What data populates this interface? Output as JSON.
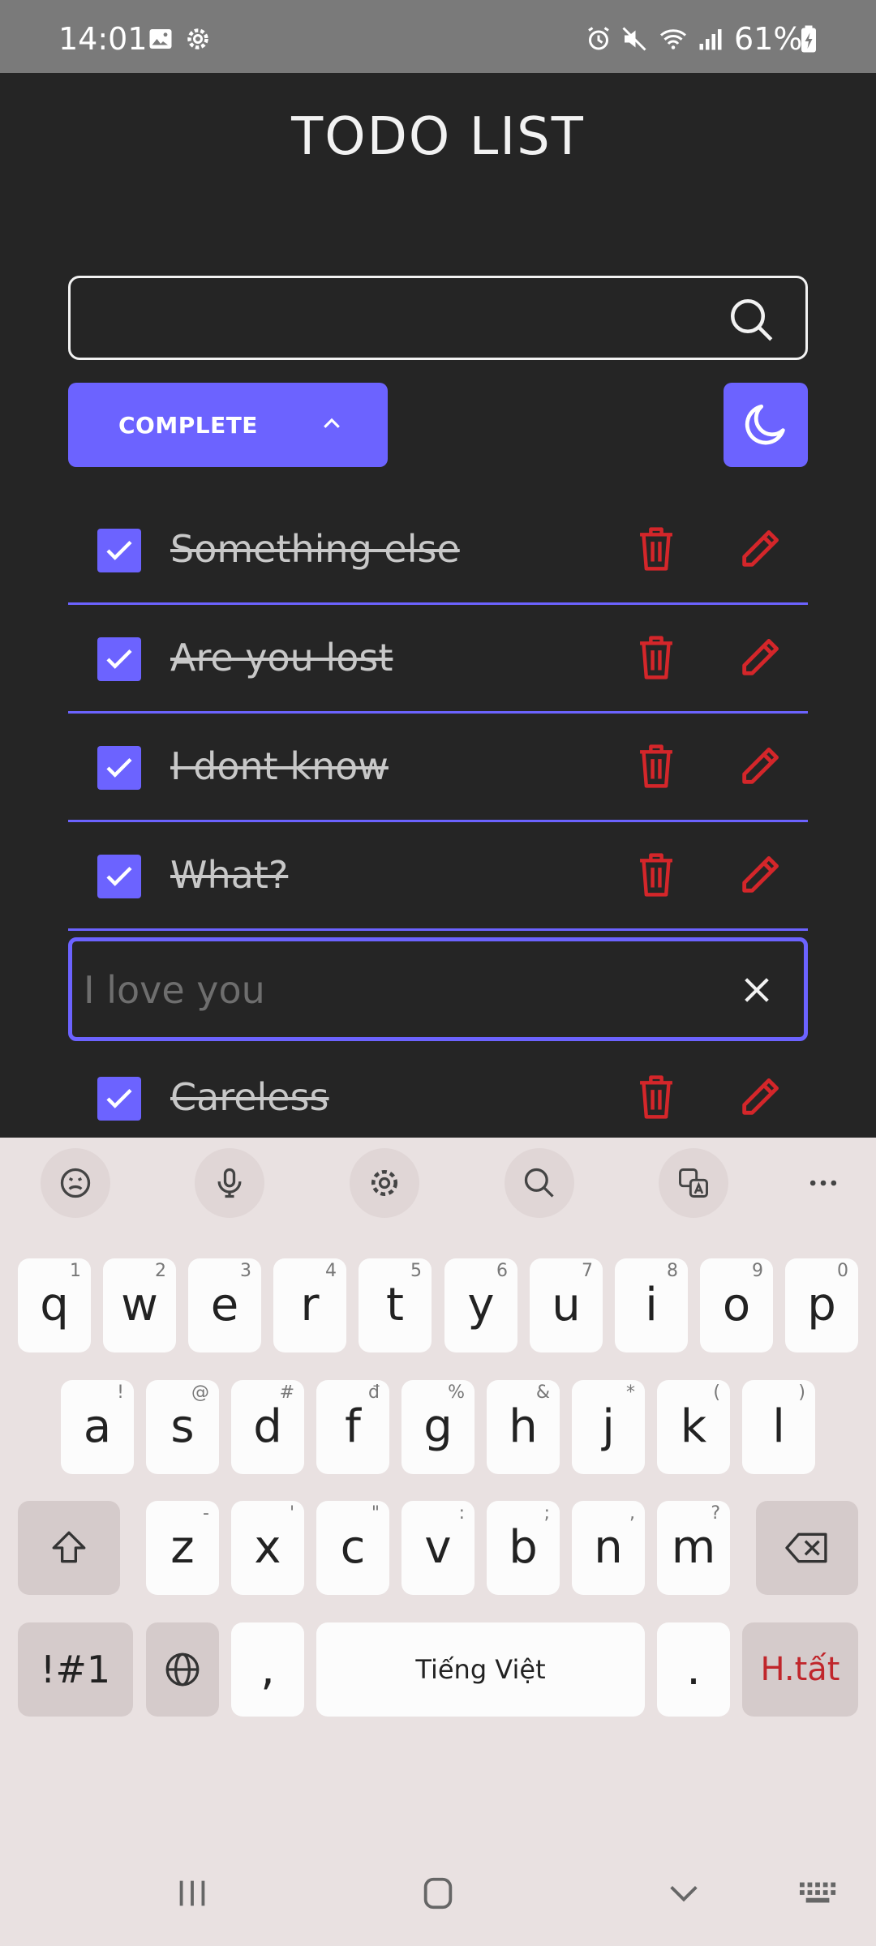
{
  "status_bar": {
    "time": "14:01",
    "battery": "61%",
    "icons": [
      "gallery-icon",
      "settings-icon",
      "alarm-icon",
      "mute-icon",
      "wifi-icon",
      "signal-icon",
      "battery-charging-icon"
    ]
  },
  "app": {
    "title": "TODO LIST",
    "search": {
      "value": "",
      "placeholder": ""
    },
    "filter_label": "COMPLETE",
    "todos": [
      {
        "text": "Something else",
        "done": true
      },
      {
        "text": "Are you lost",
        "done": true
      },
      {
        "text": "I dont know",
        "done": true
      },
      {
        "text": "What?",
        "done": true
      },
      {
        "text": "Careless",
        "done": true
      }
    ],
    "edit_field": {
      "value": "",
      "placeholder": "I love you"
    },
    "colors": {
      "accent": "#6c63ff",
      "danger": "#d4262a",
      "background": "#252525"
    }
  },
  "keyboard": {
    "toolbar": [
      "emoji-icon",
      "microphone-icon",
      "settings-icon",
      "search-icon",
      "translate-icon",
      "more-icon"
    ],
    "row1": [
      {
        "k": "q",
        "h": "1"
      },
      {
        "k": "w",
        "h": "2"
      },
      {
        "k": "e",
        "h": "3"
      },
      {
        "k": "r",
        "h": "4"
      },
      {
        "k": "t",
        "h": "5"
      },
      {
        "k": "y",
        "h": "6"
      },
      {
        "k": "u",
        "h": "7"
      },
      {
        "k": "i",
        "h": "8"
      },
      {
        "k": "o",
        "h": "9"
      },
      {
        "k": "p",
        "h": "0"
      }
    ],
    "row2": [
      {
        "k": "a",
        "h": "!"
      },
      {
        "k": "s",
        "h": "@"
      },
      {
        "k": "d",
        "h": "#"
      },
      {
        "k": "f",
        "h": "đ"
      },
      {
        "k": "g",
        "h": "%"
      },
      {
        "k": "h",
        "h": "&"
      },
      {
        "k": "j",
        "h": "*"
      },
      {
        "k": "k",
        "h": "("
      },
      {
        "k": "l",
        "h": ")"
      }
    ],
    "row3": [
      {
        "k": "z",
        "h": "-"
      },
      {
        "k": "x",
        "h": "'"
      },
      {
        "k": "c",
        "h": "\""
      },
      {
        "k": "v",
        "h": ":"
      },
      {
        "k": "b",
        "h": ";"
      },
      {
        "k": "n",
        "h": ","
      },
      {
        "k": "m",
        "h": "?"
      }
    ],
    "symbols_label": "!#1",
    "comma": ",",
    "space_label": "Tiếng Việt",
    "period": ".",
    "done_label": "H.tất"
  }
}
